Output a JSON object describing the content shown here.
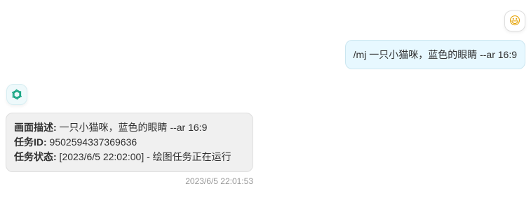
{
  "user_message": {
    "avatar_emoji": "😃",
    "text": "/mj 一只小猫咪，蓝色的眼睛 --ar 16:9"
  },
  "bot_message": {
    "avatar_icon": "openai-icon",
    "avatar_color": "#10a37f",
    "lines": [
      {
        "label": "画面描述:",
        "value": " 一只小猫咪，蓝色的眼睛 --ar 16:9"
      },
      {
        "label": "任务ID:",
        "value": " 9502594337369636"
      },
      {
        "label": "任务状态:",
        "value": " [2023/6/5 22:02:00] - 绘图任务正在运行"
      }
    ],
    "timestamp": "2023/6/5 22:01:53"
  },
  "colors": {
    "user_bubble": "#e7f8ff",
    "bot_bubble": "#f0f0f0",
    "timestamp": "#9a9a9a"
  }
}
